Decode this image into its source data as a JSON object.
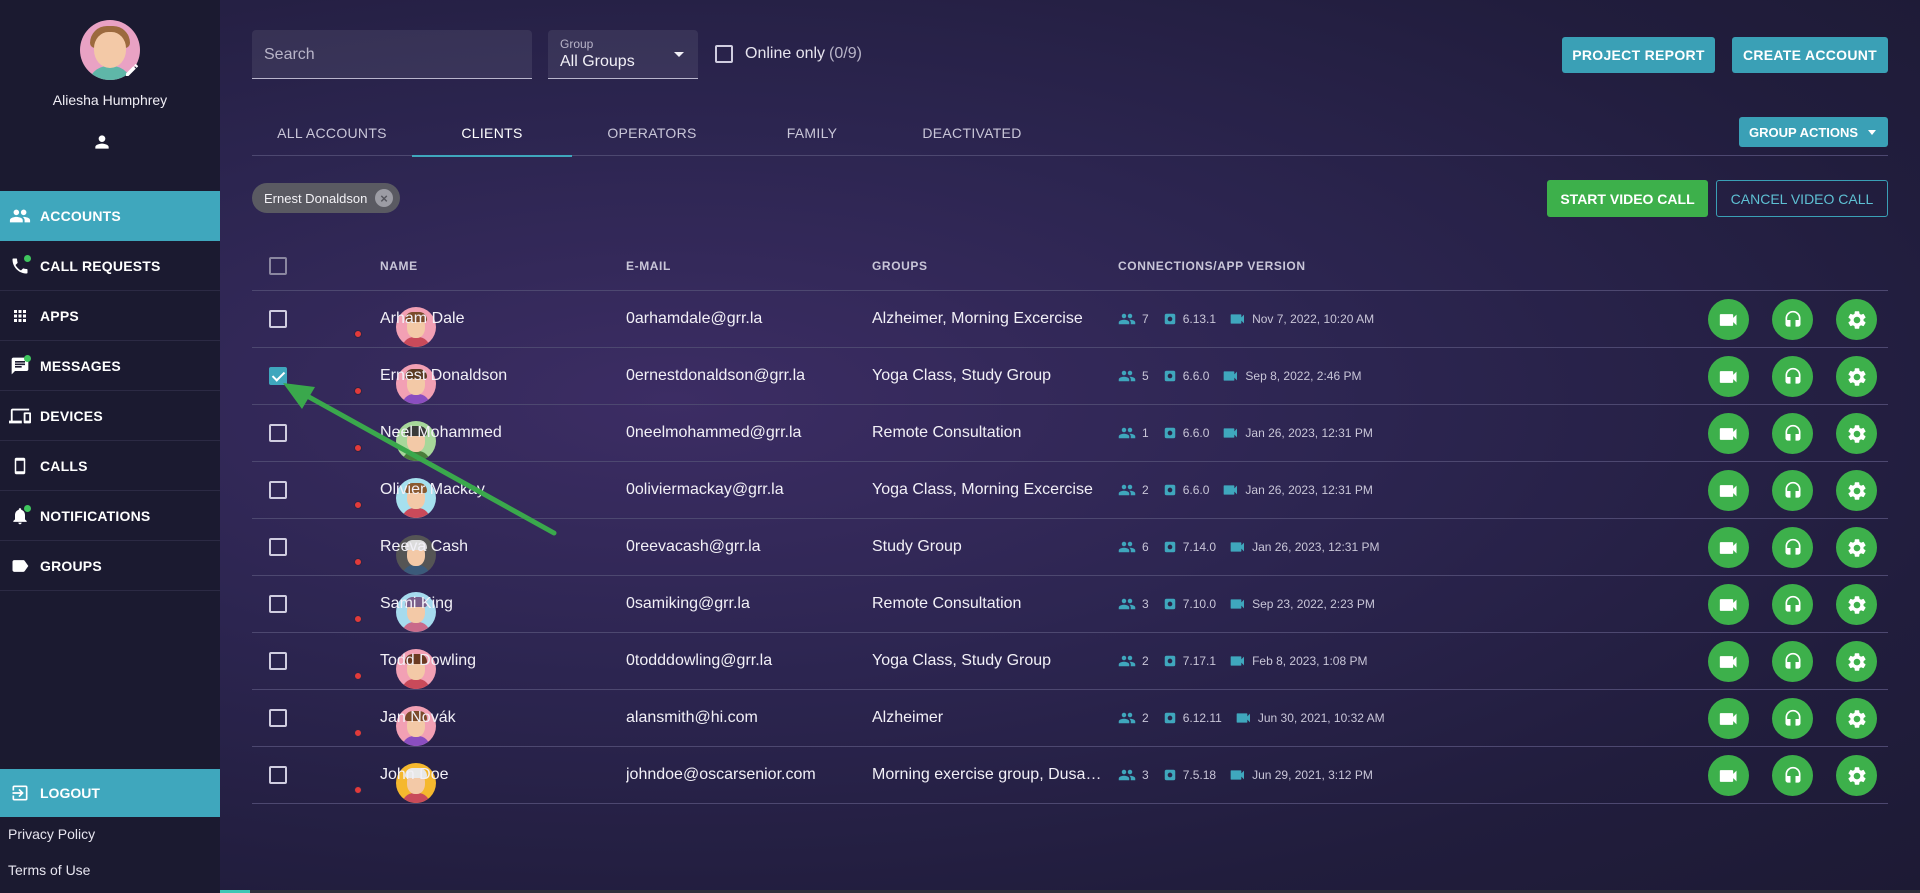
{
  "user": {
    "name": "Aliesha Humphrey"
  },
  "sidebar": {
    "items": [
      {
        "label": "ACCOUNTS",
        "icon": "people-icon",
        "active": true,
        "dot": false
      },
      {
        "label": "CALL REQUESTS",
        "icon": "phone-icon",
        "active": false,
        "dot": true
      },
      {
        "label": "APPS",
        "icon": "apps-grid-icon",
        "active": false,
        "dot": false
      },
      {
        "label": "MESSAGES",
        "icon": "message-icon",
        "active": false,
        "dot": true
      },
      {
        "label": "DEVICES",
        "icon": "devices-icon",
        "active": false,
        "dot": false
      },
      {
        "label": "CALLS",
        "icon": "smartphone-icon",
        "active": false,
        "dot": false
      },
      {
        "label": "NOTIFICATIONS",
        "icon": "bell-icon",
        "active": false,
        "dot": true
      },
      {
        "label": "GROUPS",
        "icon": "label-icon",
        "active": false,
        "dot": false
      }
    ],
    "logout": "LOGOUT",
    "privacy": "Privacy Policy",
    "terms": "Terms of Use"
  },
  "toolbar": {
    "search_placeholder": "Search",
    "group_label": "Group",
    "group_value": "All Groups",
    "online_label": "Online only",
    "online_count": "(0/9)",
    "project_report": "PROJECT REPORT",
    "create_account": "CREATE ACCOUNT"
  },
  "tabs": [
    "ALL ACCOUNTS",
    "CLIENTS",
    "OPERATORS",
    "FAMILY",
    "DEACTIVATED"
  ],
  "active_tab": "CLIENTS",
  "group_actions": "GROUP ACTIONS",
  "chip": "Ernest Donaldson",
  "start_video_call": "START VIDEO CALL",
  "cancel_video_call": "CANCEL VIDEO CALL",
  "table": {
    "headers": {
      "name": "NAME",
      "email": "E-MAIL",
      "groups": "GROUPS",
      "conn": "CONNECTIONS/APP VERSION"
    },
    "rows": [
      {
        "name": "Arham Dale",
        "email": "0arhamdale@grr.la",
        "groups": "Alzheimer, Morning Excercise",
        "connections": "7",
        "version": "6.13.1",
        "last_call": "Nov 7, 2022, 10:20 AM",
        "checked": false,
        "avatar_bg": "#f2a0b4",
        "hair": "#7a4b2b",
        "shirt": "#c94a5a"
      },
      {
        "name": "Ernest Donaldson",
        "email": "0ernestdonaldson@grr.la",
        "groups": "Yoga Class, Study Group",
        "connections": "5",
        "version": "6.6.0",
        "last_call": "Sep 8, 2022, 2:46 PM",
        "checked": true,
        "avatar_bg": "#f2a0b4",
        "hair": "#5a3a22",
        "shirt": "#8a4ec0"
      },
      {
        "name": "Neel Mohammed",
        "email": "0neelmohammed@grr.la",
        "groups": "Remote Consultation",
        "connections": "1",
        "version": "6.6.0",
        "last_call": "Jan 26, 2023, 12:31 PM",
        "checked": false,
        "avatar_bg": "#a7d79a",
        "hair": "#3a3a3a",
        "shirt": "#4a7d3a"
      },
      {
        "name": "Olivier Mackay",
        "email": "0oliviermackay@grr.la",
        "groups": "Yoga Class, Morning Excercise",
        "connections": "2",
        "version": "6.6.0",
        "last_call": "Jan 26, 2023, 12:31 PM",
        "checked": false,
        "avatar_bg": "#a6e0ee",
        "hair": "#8a5a30",
        "shirt": "#c94a5a"
      },
      {
        "name": "Reeva Cash",
        "email": "0reevacash@grr.la",
        "groups": "Study Group",
        "connections": "6",
        "version": "7.14.0",
        "last_call": "Jan 26, 2023, 12:31 PM",
        "checked": false,
        "avatar_bg": "#555555",
        "hair": "#dcdcdc",
        "shirt": "#3b5a7a"
      },
      {
        "name": "Sami King",
        "email": "0samiking@grr.la",
        "groups": "Remote Consultation",
        "connections": "3",
        "version": "7.10.0",
        "last_call": "Sep 23, 2022, 2:23 PM",
        "checked": false,
        "avatar_bg": "#a6dbee",
        "hair": "#7a5e8a",
        "shirt": "#c96a8a"
      },
      {
        "name": "Todd Dowling",
        "email": "0todddowling@grr.la",
        "groups": "Yoga Class, Study Group",
        "connections": "2",
        "version": "7.17.1",
        "last_call": "Feb 8, 2023, 1:08 PM",
        "checked": false,
        "avatar_bg": "#f2a0b4",
        "hair": "#6b3a22",
        "shirt": "#c94a5a"
      },
      {
        "name": "Jan Novák",
        "email": "alansmith@hi.com",
        "groups": "Alzheimer",
        "connections": "2",
        "version": "6.12.11",
        "last_call": "Jun 30, 2021, 10:32 AM",
        "checked": false,
        "avatar_bg": "#f2a0b4",
        "hair": "#7a4b2b",
        "shirt": "#8a4ec0"
      },
      {
        "name": "John Doe",
        "email": "johndoe@oscarsenior.com",
        "groups": "Morning exercise group, Dusa…",
        "connections": "3",
        "version": "7.5.18",
        "last_call": "Jun 29, 2021, 3:12 PM",
        "checked": false,
        "avatar_bg": "#f5b82e",
        "hair": "#e8e8e8",
        "shirt": "#c94a5a"
      }
    ]
  },
  "colors": {
    "accent": "#3fa7bd",
    "green": "#3db04b",
    "sidebar": "#1b1a30",
    "annotation_arrow": "#3aa84c"
  }
}
